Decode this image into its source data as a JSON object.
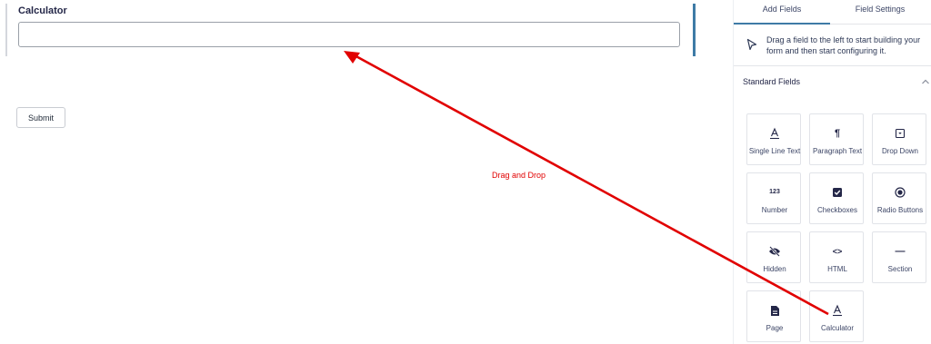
{
  "form": {
    "field_label": "Calculator",
    "field_value": "",
    "submit_label": "Submit"
  },
  "annotation": {
    "text": "Drag and Drop",
    "color": "#e10000"
  },
  "sidebar": {
    "tabs": [
      {
        "label": "Add Fields",
        "active": true
      },
      {
        "label": "Field Settings",
        "active": false
      }
    ],
    "hint": "Drag a field to the left to start building your form and then start configuring it.",
    "section_title": "Standard Fields",
    "fields": [
      {
        "label": "Single Line Text",
        "icon": "text-a-underline-icon"
      },
      {
        "label": "Paragraph Text",
        "icon": "pilcrow-icon"
      },
      {
        "label": "Drop Down",
        "icon": "dropdown-box-icon"
      },
      {
        "label": "Number",
        "icon": "number-123-icon"
      },
      {
        "label": "Checkboxes",
        "icon": "checkbox-icon"
      },
      {
        "label": "Radio Buttons",
        "icon": "radio-icon"
      },
      {
        "label": "Hidden",
        "icon": "eye-slash-icon"
      },
      {
        "label": "HTML",
        "icon": "code-brackets-icon"
      },
      {
        "label": "Section",
        "icon": "horizontal-rule-icon"
      },
      {
        "label": "Page",
        "icon": "document-icon"
      },
      {
        "label": "Calculator",
        "icon": "text-a-underline-icon"
      }
    ],
    "icon_glyphs": {
      "pilcrow": "¶",
      "number": "123",
      "code": "<>",
      "rule": "—"
    }
  },
  "colors": {
    "accent": "#3e7ba6",
    "annotation": "#e10000"
  }
}
